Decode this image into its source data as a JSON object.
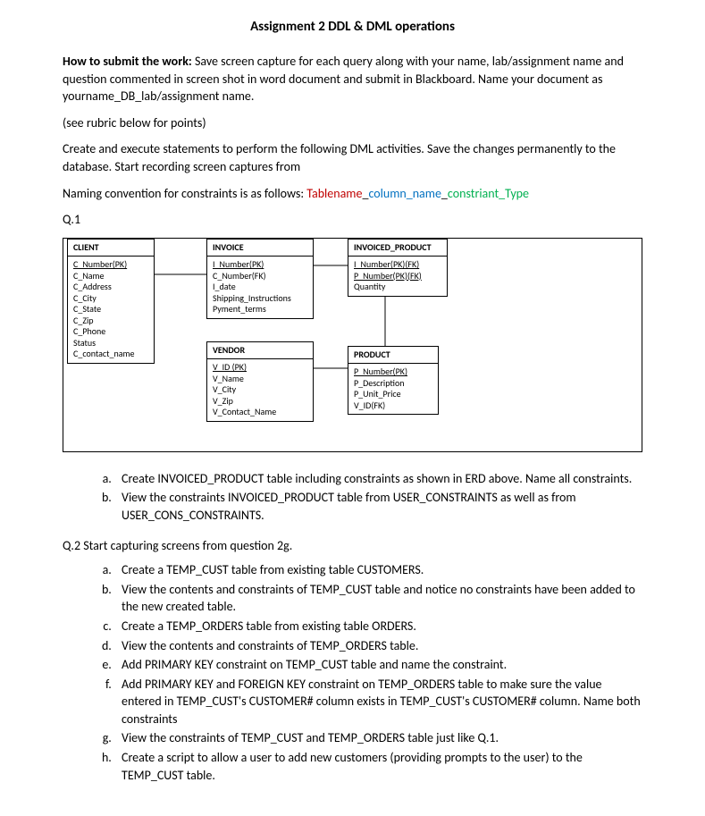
{
  "title": "Assignment 2 DDL & DML operations",
  "howto_label": "How to submit the work:",
  "howto_text": " Save screen capture for each query along with your name, lab/assignment name and question commented in screen shot in word document and submit in Blackboard. Name your document as yourname_DB_lab/assignment name.",
  "rubric_note": "(see rubric below for points)",
  "create_stmt": "Create and execute statements to perform the following DML activities. Save the changes permanently to the database. Start recording screen captures from",
  "naming_prefix": "Naming convention for constraints is as follows: ",
  "naming_red": "Tablename",
  "naming_sep1": "_",
  "naming_blue": "column_name",
  "naming_sep2": "_",
  "naming_green": "constriant_Type",
  "q1_label": "Q.1",
  "erd": {
    "client": {
      "title": "CLIENT",
      "rows": [
        "C_Number(PK)",
        "C_Name",
        "C_Address",
        "C_City",
        "C_State",
        "C_Zip",
        "C_Phone",
        "Status",
        "C_contact_name"
      ]
    },
    "invoice": {
      "title": "INVOICE",
      "rows": [
        "I_Number(PK)",
        "C_Number(FK)",
        "I_date",
        "Shipping_Instructions",
        "Pyment_terms"
      ]
    },
    "invoiced_product": {
      "title": "INVOICED_PRODUCT",
      "rows": [
        "I_Number(PK)(FK)",
        "P_Number(PK)(FK)",
        "Quantity"
      ]
    },
    "vendor": {
      "title": "VENDOR",
      "rows": [
        "V_ID (PK)",
        "V_Name",
        "V_City",
        "V_Zip",
        "V_Contact_Name"
      ]
    },
    "product": {
      "title": "PRODUCT",
      "rows": [
        "P_Number(PK)",
        "P_Description",
        "P_Unit_Price",
        "V_ID(FK)"
      ]
    }
  },
  "q1_items": {
    "a": "Create INVOICED_PRODUCT table including constraints as shown in ERD above. Name all constraints.",
    "b": "View the constraints INVOICED_PRODUCT table from USER_CONSTRAINTS as well as from USER_CONS_CONSTRAINTS."
  },
  "q2_label": "Q.2 Start capturing screens from question 2g.",
  "q2_items": {
    "a": "Create a TEMP_CUST table from existing table CUSTOMERS.",
    "b": "View the contents and constraints of TEMP_CUST table and notice no constraints have been added to the new created table.",
    "c": "Create a TEMP_ORDERS table from existing table ORDERS.",
    "d": "View the contents and constraints of TEMP_ORDERS table.",
    "e": "Add PRIMARY KEY constraint on TEMP_CUST table and name the constraint.",
    "f": "Add PRIMARY KEY and FOREIGN KEY constraint on TEMP_ORDERS table to make sure the value entered in TEMP_CUST's CUSTOMER# column exists in TEMP_CUST's CUSTOMER# column. Name both constraints",
    "g": "View the constraints of TEMP_CUST and TEMP_ORDERS table just like Q.1.",
    "h": "Create a script to allow a user to add new customers (providing prompts to the user) to the TEMP_CUST table."
  }
}
